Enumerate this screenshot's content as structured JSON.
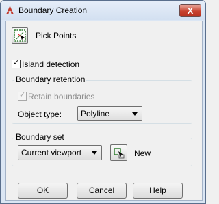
{
  "window": {
    "title": "Boundary Creation",
    "close_label": "X"
  },
  "pick_points": {
    "label": "Pick Points",
    "icon": "pick-points-icon"
  },
  "island_detection": {
    "label": "Island detection",
    "checked": true
  },
  "boundary_retention": {
    "title": "Boundary retention",
    "retain_boundaries": {
      "label": "Retain boundaries",
      "checked": true,
      "disabled": true
    },
    "object_type": {
      "label": "Object type:",
      "value": "Polyline"
    }
  },
  "boundary_set": {
    "title": "Boundary set",
    "value": "Current viewport",
    "select_icon": "select-objects-icon",
    "new_label": "New"
  },
  "buttons": {
    "ok": "OK",
    "cancel": "Cancel",
    "help": "Help"
  }
}
